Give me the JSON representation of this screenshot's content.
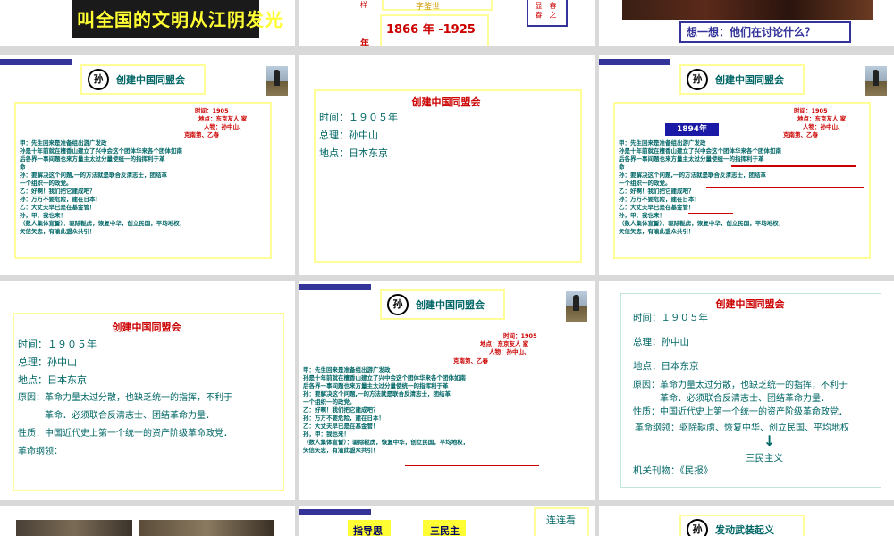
{
  "colors": {
    "accent_blue": "#333399",
    "teal_text": "#006666",
    "red_text": "#cc0000",
    "frame_yellow": "#ffff99"
  },
  "row1": {
    "s1_banner": "叫全国的文明从江阴发光",
    "s2_small_top": "字鉴世",
    "s2_years": "1866 年 -1925",
    "s2_year_char": "年",
    "s2_side_text": "显 春",
    "s2_side_text2": "春 之",
    "s2_red_tick": "样",
    "s3_question": "想一想：他们在讨论什么？"
  },
  "slideA": {
    "title": "创建中国同盟会",
    "meta": [
      "时间：1905",
      "地点：东京友人 家",
      "人物：孙中山、",
      "克南第、乙春"
    ],
    "dialog": [
      "甲：先生回来是准备组出游广发政",
      "孙是十年前就在檀香山建立了兴中会这个团体华来各个团体如南",
      "后各界一事间题也来方量主太过分量使统一的指挥利于革",
      "命",
      "孙：要解决这个问题,一的方法就是联合反清志士，团结革",
      "一个组织一的政党。",
      "乙：好啊！我们把它建成吧？",
      "孙：万万不要危险，建在日本！",
      "乙：大丈夫早已是在基金管！",
      "孙，甲：我也来！",
      "（数人集体宣誓）：驱除鞑虏，恢复中华，创立民国，平均地权，",
      "矢信矢忠，有渝此盟众共引！"
    ]
  },
  "slideB": {
    "title": "创建中国同盟会",
    "lines": [
      "时间：１９０５年",
      "总理：孙中山",
      "地点：日本东京"
    ]
  },
  "slideC": {
    "year_tag": "1894年",
    "title": "创建中国同盟会"
  },
  "slideD": {
    "title": "创建中国同盟会",
    "lines": [
      "时间：１９０５年",
      "总理：孙中山",
      "地点：日本东京",
      "原因：革命力量太过分散，也缺乏统一的指挥，不利于",
      "　　　革命．必须联合反清志士、团结革命力量．",
      "性质：中国近代史上第一个统一的资产阶级革命政党．",
      "革命纲领："
    ]
  },
  "slideE": {
    "title": "创建中国同盟会"
  },
  "slideF": {
    "title": "创建中国同盟会",
    "lines": [
      "时间：１９０５年",
      "总理：孙中山",
      "地点：日本东京",
      "原因：革命力量太过分散，也缺乏统一的指挥，不利于",
      "　　　革命．必须联合反清志士、团结革命力量．",
      "性质：中国近代史上第一个统一的资产阶级革命政党．"
    ],
    "program": "革命纲领：驱除鞑虏、恢复中华、创立民国、平均地权",
    "arrow": "↓",
    "three_principles": "三民主义",
    "journal": "机关刊物：《民报》"
  },
  "row3": {
    "box1": "指导思",
    "box2": "三民主",
    "link": "连连看",
    "title": "发动武装起义"
  }
}
